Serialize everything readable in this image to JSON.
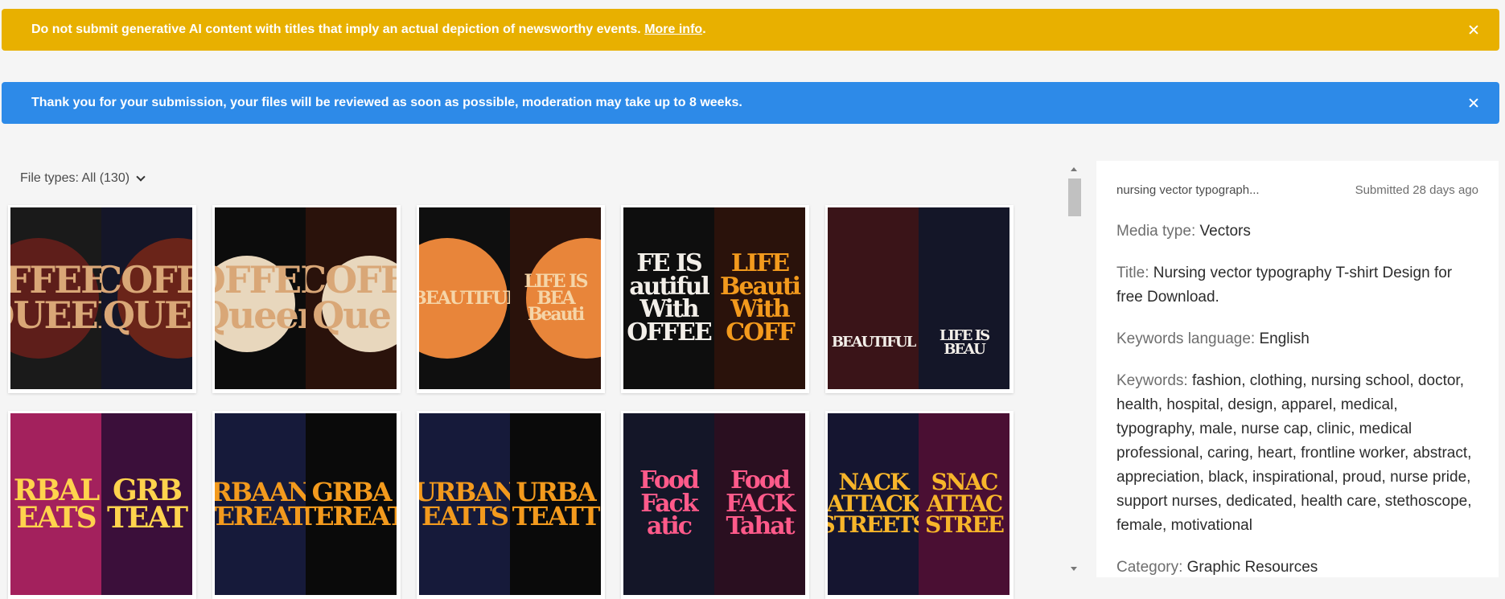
{
  "banners": {
    "warning": {
      "text": "Do not submit generative AI content with titles that imply an actual depiction of newsworthy events.",
      "link": "More info",
      "after": ".",
      "color": "#e8b000"
    },
    "info": {
      "text": "Thank you for your submission, your files will be reviewed as soon as possible, moderation may take up to 8 weeks.",
      "color": "#2d8ae8"
    }
  },
  "filter": {
    "label": "File types: All (130)"
  },
  "tiles": [
    {
      "left": "FFEE QUEEN",
      "right": "COFF QUE"
    },
    {
      "left": "OFFEE Queen",
      "right": "COFF Que"
    },
    {
      "left": "BEAUTIFUL",
      "right": "LIFE IS BEA Beauti"
    },
    {
      "left": "FE IS autiful With OFFEE",
      "right": "LIFE Beauti With COFF"
    },
    {
      "left": "BEAUTIFUL",
      "right": "LIFE IS BEAU"
    },
    {
      "left": "RBAL EATS",
      "right": "GRB TEAT"
    },
    {
      "left": "RBAAN TEREATS",
      "right": "GRBA TEREAT"
    },
    {
      "left": "URBAN EATTS",
      "right": "URBA TEATT"
    },
    {
      "left": "Food Fack atic",
      "right": "Food FACK Tahat"
    },
    {
      "left": "NACK ATTACK STREETS",
      "right": "SNAC ATTAC STREE"
    }
  ],
  "panel": {
    "filename": "nursing vector typograph...",
    "submitted": "Submitted 28 days ago",
    "media_type_label": "Media type:",
    "media_type": "Vectors",
    "title_label": "Title:",
    "title": "Nursing vector typography T-shirt Design for free Download.",
    "kw_lang_label": "Keywords language:",
    "kw_lang": "English",
    "keywords_label": "Keywords:",
    "keywords": "fashion, clothing, nursing school, doctor, health, hospital, design, apparel, medical, typography, male, nurse cap, clinic, medical professional, caring, heart, frontline worker, abstract, appreciation, black, inspirational, proud, nurse pride, support nurses, dedicated, health care, stethoscope, female, motivational",
    "category_label": "Category:",
    "category": "Graphic Resources"
  }
}
